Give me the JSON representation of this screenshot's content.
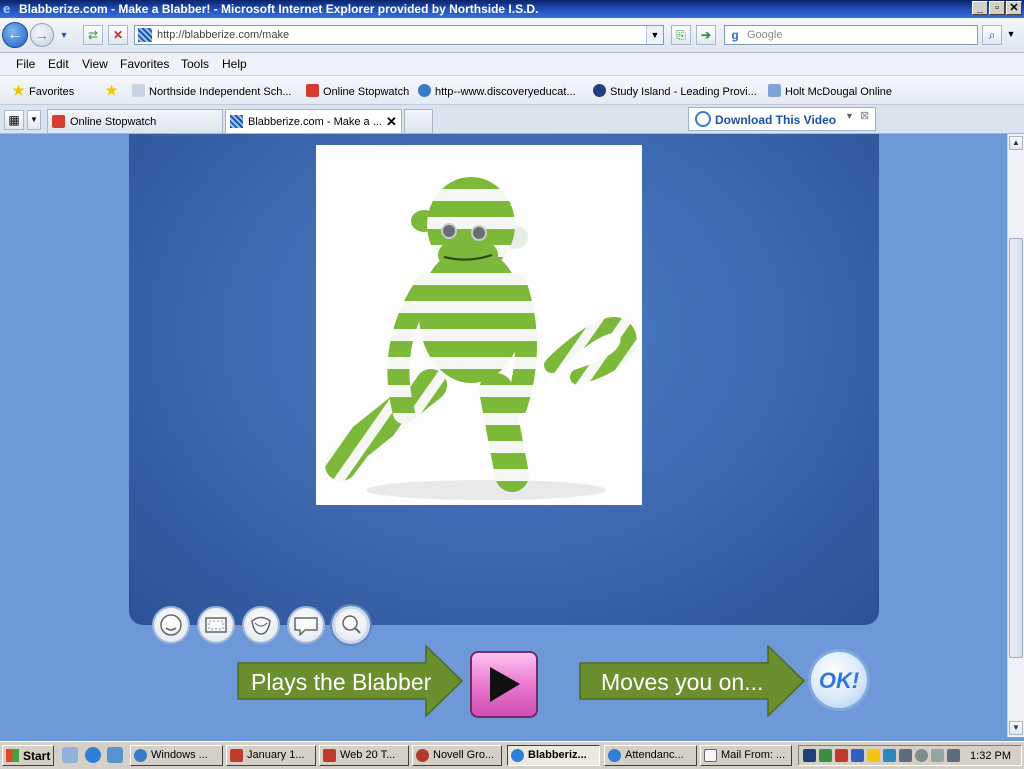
{
  "window": {
    "title": "Blabberize.com - Make a Blabber! - Microsoft Internet Explorer provided by Northside I.S.D.",
    "minimize": "_",
    "maximize": "▫",
    "close": "✕"
  },
  "addressbar": {
    "url": "http://blabberize.com/make",
    "search_placeholder": "Google"
  },
  "menu": [
    "File",
    "Edit",
    "View",
    "Favorites",
    "Tools",
    "Help"
  ],
  "favorites": {
    "label": "Favorites",
    "items": [
      "Northside Independent Sch...",
      "Online Stopwatch",
      "http--www.discoveryeducat...",
      "Study Island - Leading Provi...",
      "Holt McDougal Online"
    ]
  },
  "tabs": [
    {
      "label": "Online Stopwatch"
    },
    {
      "label": "Blabberize.com - Make a ..."
    }
  ],
  "download_video": "Download This Video",
  "blabber": {
    "play_text": "Plays the Blabber",
    "next_text": "Moves you on...",
    "ok_text": "OK!"
  },
  "taskbar": {
    "start": "Start",
    "tasks": [
      "Windows ...",
      "January 1...",
      "Web 20 T...",
      "Novell Gro...",
      "Blabberiz...",
      "Attendanc...",
      "Mail From: ..."
    ],
    "clock": "1:32 PM"
  },
  "colors": {
    "content_bg": "#6d99d9",
    "panel": "#3f6cb4",
    "arrow_green": "#6b8f2e",
    "play_pink": "#e97ad0",
    "monkey_green": "#7cb83a"
  }
}
